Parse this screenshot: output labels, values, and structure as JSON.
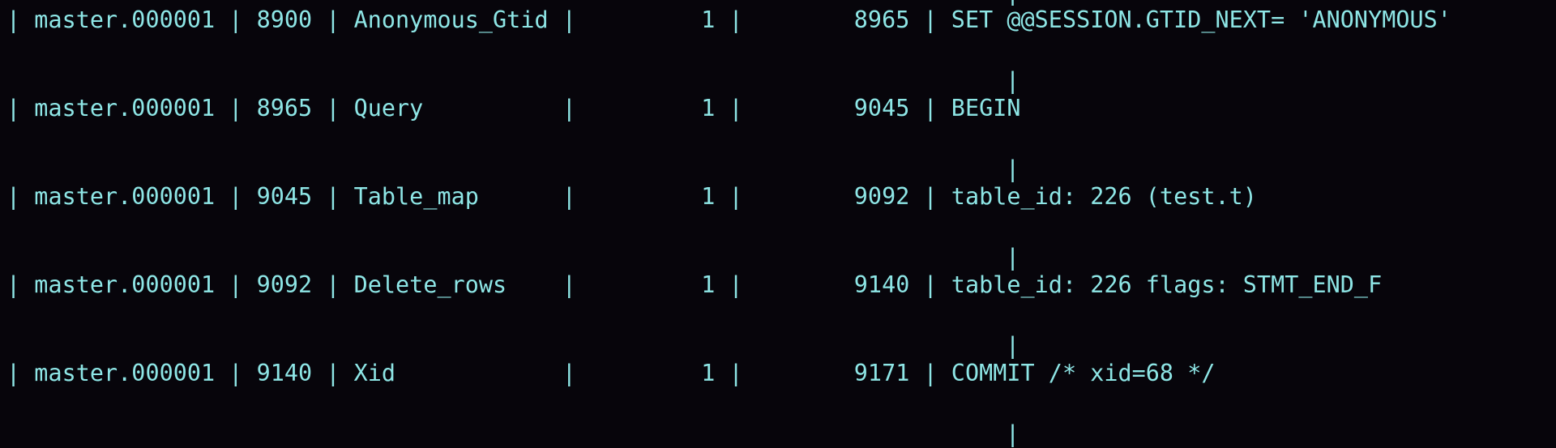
{
  "terminal": {
    "colors": {
      "background": "#07050b",
      "foreground": "#8ee6e6"
    },
    "wrapped_pipe": "|",
    "rows": [
      {
        "log_name": "master.000001",
        "pos": "8900",
        "event_type": "Anonymous_Gtid",
        "server_id": "1",
        "end_log_pos": "8965",
        "info": "SET @@SESSION.GTID_NEXT= 'ANONYMOUS'"
      },
      {
        "log_name": "master.000001",
        "pos": "8965",
        "event_type": "Query",
        "server_id": "1",
        "end_log_pos": "9045",
        "info": "BEGIN"
      },
      {
        "log_name": "master.000001",
        "pos": "9045",
        "event_type": "Table_map",
        "server_id": "1",
        "end_log_pos": "9092",
        "info": "table_id: 226 (test.t)"
      },
      {
        "log_name": "master.000001",
        "pos": "9092",
        "event_type": "Delete_rows",
        "server_id": "1",
        "end_log_pos": "9140",
        "info": "table_id: 226 flags: STMT_END_F"
      },
      {
        "log_name": "master.000001",
        "pos": "9140",
        "event_type": "Xid",
        "server_id": "1",
        "end_log_pos": "9171",
        "info": "COMMIT /* xid=68 */"
      }
    ]
  }
}
